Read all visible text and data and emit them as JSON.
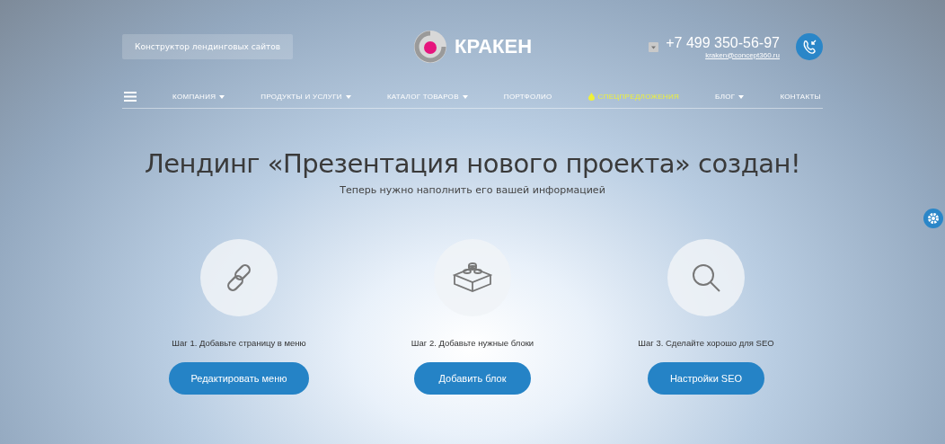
{
  "header": {
    "badge": "Конструктор лендинговых сайтов",
    "logo_text": "КРАКЕН",
    "phone": "+7 499 350-56-97",
    "email": "kraken@concept360.ru"
  },
  "nav": [
    {
      "label": "КОМПАНИЯ",
      "kind": "dropdown"
    },
    {
      "label": "ПРОДУКТЫ И УСЛУГИ",
      "kind": "dropdown"
    },
    {
      "label": "КАТАЛОГ ТОВАРОВ",
      "kind": "dropdown"
    },
    {
      "label": "ПОРТФОЛИО",
      "kind": "link"
    },
    {
      "label": "СПЕЦПРЕДЛОЖЕНИЯ",
      "kind": "special"
    },
    {
      "label": "БЛОГ",
      "kind": "dropdown"
    },
    {
      "label": "КОНТАКТЫ",
      "kind": "link"
    }
  ],
  "hero": {
    "title": "Лендинг «Презентация нового проекта» создан!",
    "subtitle": "Теперь нужно наполнить его вашей информацией"
  },
  "steps": [
    {
      "kind": "link",
      "text": "Шаг 1. Добавьте страницу в меню",
      "button": "Редактировать меню"
    },
    {
      "kind": "blocks",
      "text": "Шаг 2. Добавьте нужные блоки",
      "button": "Добавить блок"
    },
    {
      "kind": "search",
      "text": "Шаг 3. Сделайте хорошо для SEO",
      "button": "Настройки SEO"
    }
  ]
}
